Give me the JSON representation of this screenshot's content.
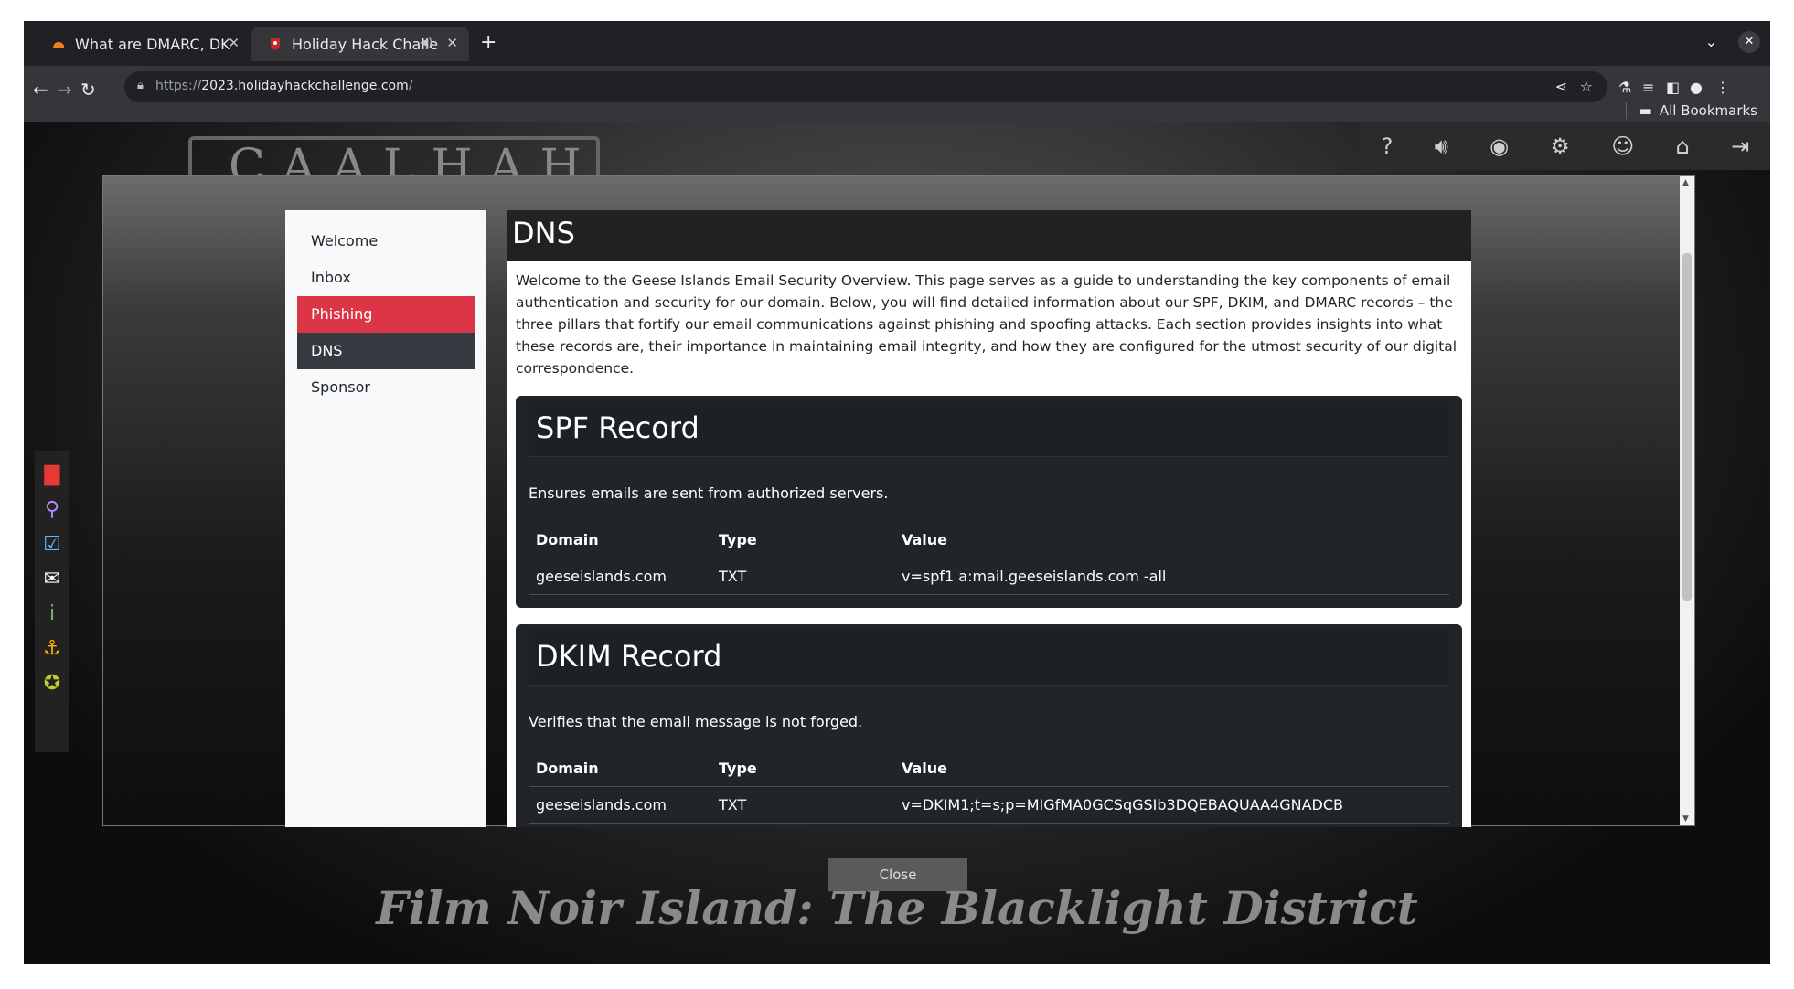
{
  "browser": {
    "tabs": [
      {
        "title": "What are DMARC, DKIM",
        "favicon": "cloudflare-icon",
        "active": false
      },
      {
        "title": "Holiday Hack Challe",
        "favicon": "hhc-icon",
        "active": true
      }
    ],
    "url_scheme": "https://",
    "url_host": "2023.holidayhackchallenge.com",
    "url_path": "/",
    "bookmarks_label": "All Bookmarks"
  },
  "game": {
    "top_icons": [
      "help-icon",
      "volume-icon",
      "discord-icon",
      "settings-icon",
      "profile-icon",
      "home-icon",
      "logout-icon"
    ],
    "left_icons": [
      "book-icon",
      "map-pin-icon",
      "checklist-icon",
      "chat-icon",
      "info-icon",
      "anchor-icon",
      "badge-icon"
    ],
    "sign_text": "CAALHAH",
    "location": "Film Noir Island: The Blacklight District",
    "close_label": "Close"
  },
  "nav": {
    "items": [
      {
        "label": "Welcome"
      },
      {
        "label": "Inbox"
      },
      {
        "label": "Phishing"
      },
      {
        "label": "DNS"
      },
      {
        "label": "Sponsor"
      }
    ]
  },
  "main": {
    "title": "DNS",
    "intro": "Welcome to the Geese Islands Email Security Overview. This page serves as a guide to understanding the key components of email authentication and security for our domain. Below, you will find detailed information about our SPF, DKIM, and DMARC records – the three pillars that fortify our email communications against phishing and spoofing attacks. Each section provides insights into what these records are, their importance in maintaining email integrity, and how they are configured for the utmost security of our digital correspondence.",
    "columns": [
      "Domain",
      "Type",
      "Value"
    ],
    "spf": {
      "title": "SPF Record",
      "description": "Ensures emails are sent from authorized servers.",
      "row": [
        "geeseislands.com",
        "TXT",
        "v=spf1 a:mail.geeseislands.com -all"
      ]
    },
    "dkim": {
      "title": "DKIM Record",
      "description": "Verifies that the email message is not forged.",
      "row": [
        "geeseislands.com",
        "TXT",
        "v=DKIM1;t=s;p=MIGfMA0GCSqGSIb3DQEBAQUAA4GNADCB"
      ]
    }
  }
}
